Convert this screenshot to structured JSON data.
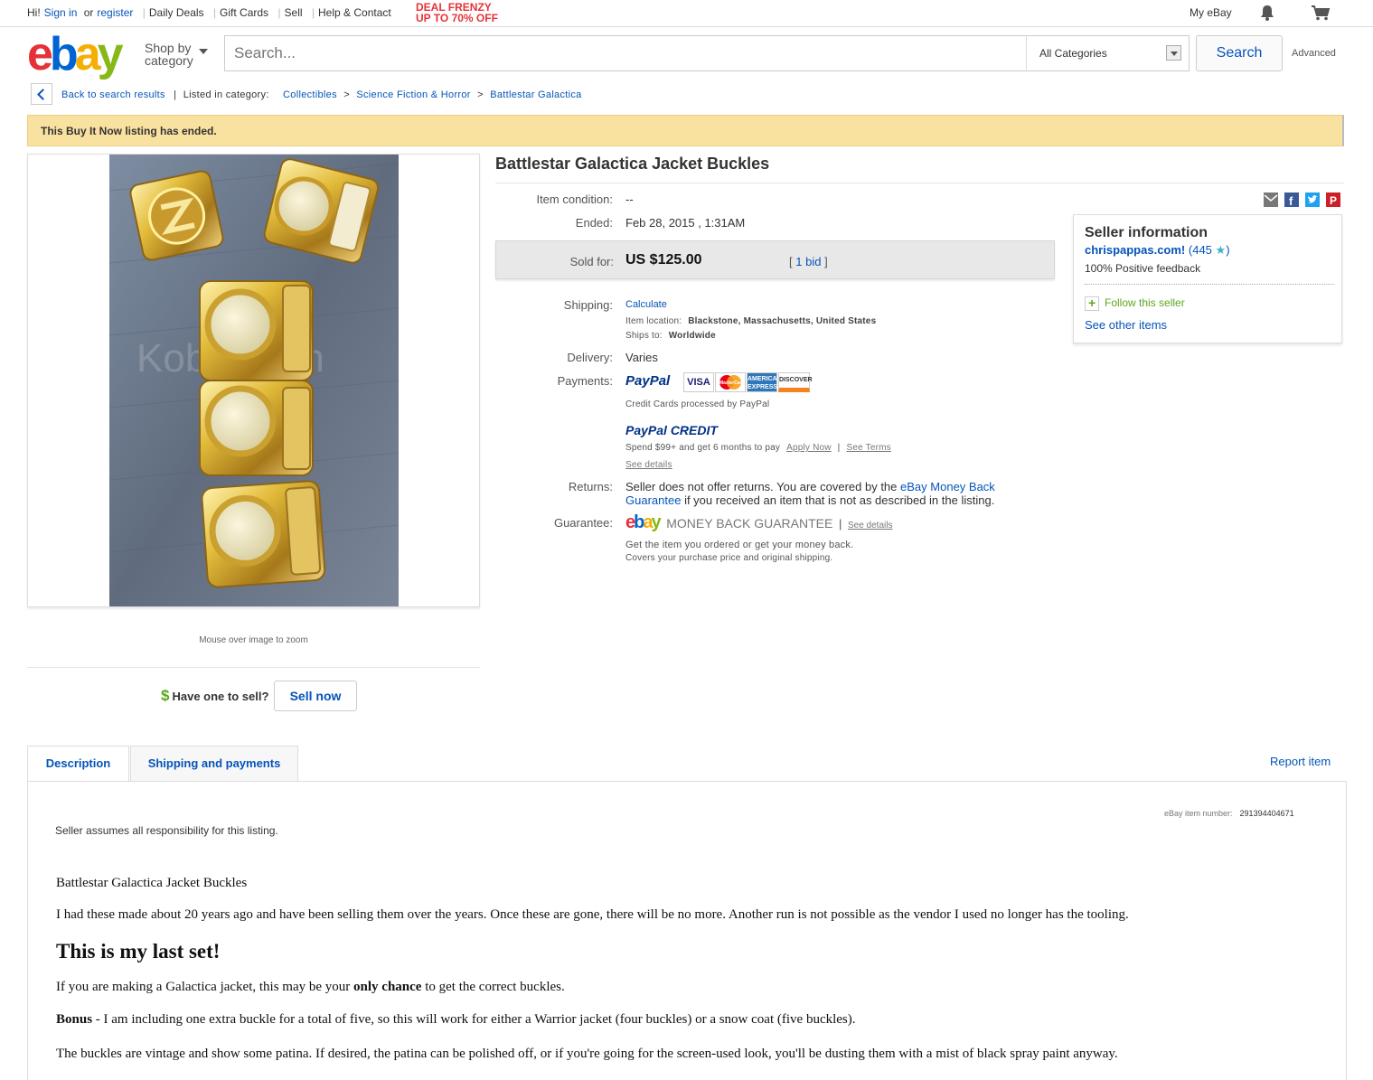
{
  "topbar": {
    "hi": "Hi!",
    "sign_in": "Sign in",
    "or": "or",
    "register": "register",
    "daily_deals": "Daily Deals",
    "gift_cards": "Gift Cards",
    "sell": "Sell",
    "help": "Help & Contact",
    "deal_line1": "DEAL FRENZY",
    "deal_line2": "UP TO 70% OFF",
    "my_ebay": "My eBay"
  },
  "header": {
    "logo": [
      "e",
      "b",
      "a",
      "y"
    ],
    "shop_by_line1": "Shop by",
    "shop_by_line2": "category",
    "search_placeholder": "Search...",
    "category": "All Categories",
    "search_button": "Search",
    "advanced": "Advanced"
  },
  "breadcrumb": {
    "back": "Back to search results",
    "listed_in": "Listed in category:",
    "path": [
      "Collectibles",
      "Science Fiction & Horror",
      "Battlestar Galactica"
    ]
  },
  "banner": "This Buy It Now listing has ended.",
  "image": {
    "watermark": "Kobol.com",
    "zoom_hint": "Mouse over image to zoom"
  },
  "sell_prompt": {
    "dollar": "$",
    "text": "Have one to sell?",
    "button": "Sell now"
  },
  "item": {
    "title": "Battlestar Galactica Jacket Buckles",
    "condition_label": "Item condition:",
    "condition": "--",
    "ended_label": "Ended:",
    "ended": "Feb 28, 2015 , 1:31AM",
    "sold_label": "Sold for:",
    "sold_price": "US $125.00",
    "bids_open": "[",
    "bids": "1 bid",
    "bids_close": "]",
    "shipping_label": "Shipping:",
    "shipping": "Calculate",
    "location_label": "Item location:",
    "location": "Blackstone, Massachusetts, United States",
    "ships_to_label": "Ships to:",
    "ships_to": "Worldwide",
    "delivery_label": "Delivery:",
    "delivery": "Varies",
    "payments_label": "Payments:",
    "paypal": "PayPal",
    "cards": [
      "VISA",
      "MasterCard",
      "AMERICAN EXPRESS",
      "DISCOVER"
    ],
    "cc_note": "Credit Cards processed by PayPal",
    "paypal_credit": "PayPal CREDIT",
    "credit_offer": "Spend $99+ and get 6 months to pay",
    "apply_now": "Apply Now",
    "see_terms": "See Terms",
    "see_details": "See details",
    "returns_label": "Returns:",
    "returns_text": "Seller does not offer returns. You are covered by the",
    "returns_link": "eBay Money Back",
    "returns_link2": "Guarantee",
    "returns_text2": "if you received an item that is not as described in the listing.",
    "guarantee_label": "Guarantee:",
    "guarantee_brand": "MONEY BACK GUARANTEE",
    "guarantee_details": "See details",
    "guarantee_line1": "Get the item you ordered or get your money back.",
    "guarantee_line2": "Covers your purchase price and original shipping."
  },
  "seller": {
    "heading": "Seller information",
    "name": "chrispappas.com!",
    "score": "(445",
    "score_close": ")",
    "feedback": "100% Positive feedback",
    "follow": "Follow this seller",
    "other": "See other items"
  },
  "tabs": {
    "description": "Description",
    "shipping": "Shipping and payments",
    "report": "Report item"
  },
  "description": {
    "item_no_label": "eBay item number:",
    "item_no": "291394404671",
    "assumes": "Seller assumes all responsibility for this listing.",
    "p1": "Battlestar Galactica Jacket Buckles",
    "p2": "I had these made about 20 years ago and have been selling them over the years. Once these are gone, there will be no more.  Another run is not possible as the vendor I used no longer has the tooling.",
    "heading": "This is my last set!",
    "p3a": "If you are making a Galactica jacket, this may be your",
    "p3b": "only chance",
    "p3c": "to get the correct buckles.",
    "p4a": "Bonus",
    "p4b": "- I am including one extra buckle for a total of five, so this will work for either a Warrior jacket (four buckles) or a snow coat (five buckles).",
    "p5": "The buckles are vintage and show some patina. If desired, the patina can be polished off, or if you're going for the screen-used look, you'll be dusting them with a mist of black spray paint anyway."
  }
}
